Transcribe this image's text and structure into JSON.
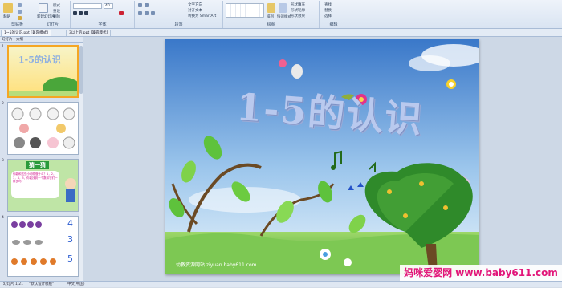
{
  "ribbon": {
    "groups": [
      {
        "id": "clipboard",
        "label": "剪贴板"
      },
      {
        "id": "slides",
        "label": "幻灯片"
      },
      {
        "id": "font",
        "label": "字体"
      },
      {
        "id": "paragraph",
        "label": "段落"
      },
      {
        "id": "drawing",
        "label": "绘图"
      },
      {
        "id": "editing",
        "label": "编辑"
      }
    ],
    "buttons": {
      "paste": "粘贴",
      "new_slide": "新建幻灯片",
      "layout": "版式",
      "reset": "重设",
      "delete": "删除",
      "text_direction": "文字方向",
      "align_text": "对齐文本",
      "smartart": "转换为 SmartArt",
      "arrange": "排列",
      "quick_styles": "快速样式",
      "shape_fill": "形状填充",
      "shape_outline": "形状轮廓",
      "shape_effects": "形状效果",
      "find": "查找",
      "replace": "替换",
      "select": "选择"
    },
    "font_size": "40"
  },
  "doc_tabs": [
    "1~5的认识.ppt [兼容模式]",
    "3以上的.ppt [兼容模式]"
  ],
  "pane_tabs": [
    "幻灯片",
    "大纲"
  ],
  "thumbnails": [
    {
      "number": "1",
      "title": "1-5的认识"
    },
    {
      "number": "2",
      "title": ""
    },
    {
      "number": "3",
      "title": "猜一猜",
      "bubble": "你能和这些小动物做什么？1，2，3，4，5，你能找到一个数和它们一样多吗？"
    },
    {
      "number": "4",
      "digits": [
        "4",
        "3",
        "5"
      ]
    }
  ],
  "slide": {
    "title": "1-5的认识",
    "credit": "幼教资源网站  ziyuan.baby611.com"
  },
  "watermark": "妈咪爱婴网 www.baby611.com",
  "status": {
    "slide_indicator": "幻灯片 1/21",
    "theme": "\"默认设计模板\"",
    "language": "中文(中国)"
  }
}
